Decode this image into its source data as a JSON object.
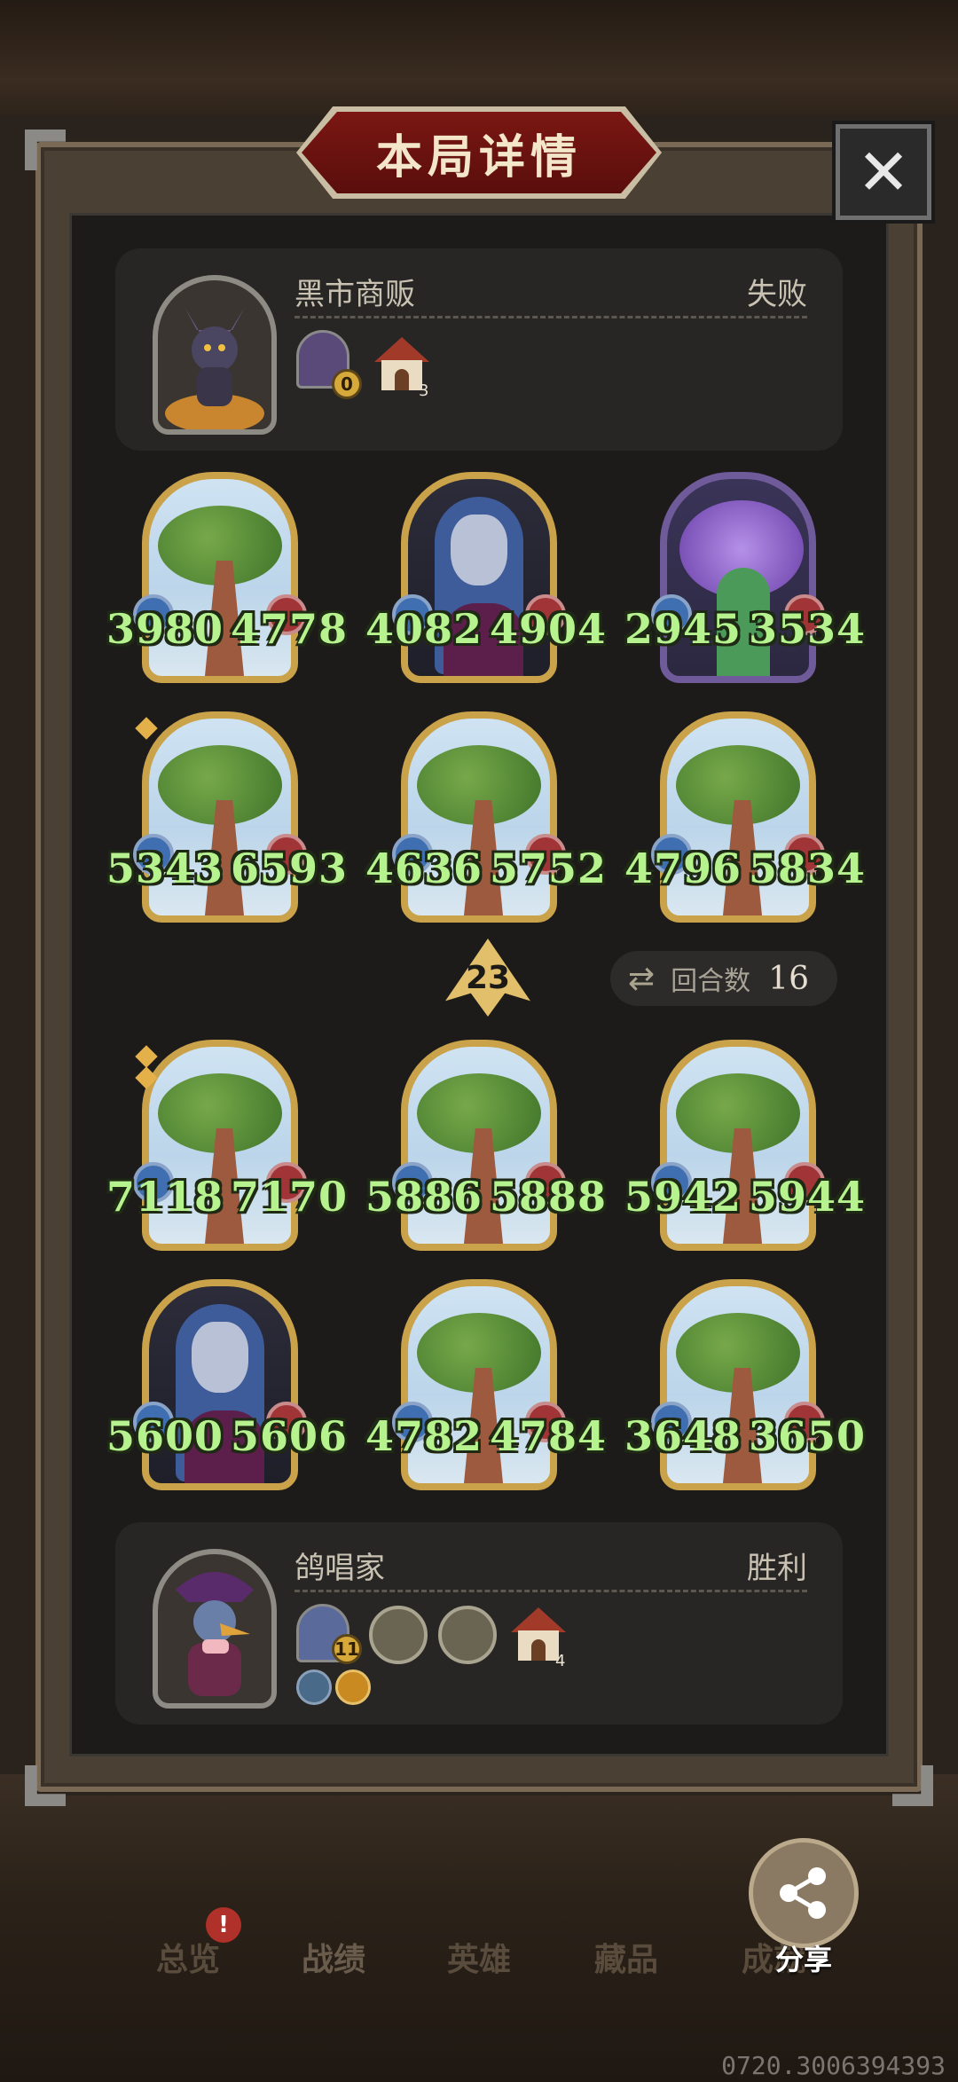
{
  "header": {
    "title": "本局详情",
    "close_label": "✕"
  },
  "opponent": {
    "name": "黑市商贩",
    "result": "失败",
    "gold": "0",
    "hut_count": "3"
  },
  "player": {
    "name": "鸽唱家",
    "result": "胜利",
    "gold": "11",
    "hut_count": "4"
  },
  "opponent_board": [
    {
      "type": "tree",
      "attack": "3980",
      "health": "4778"
    },
    {
      "type": "elf",
      "attack": "4082",
      "health": "4904"
    },
    {
      "type": "fairy",
      "attack": "2945",
      "health": "3534"
    },
    {
      "type": "tree",
      "attack": "5343",
      "health": "6593"
    },
    {
      "type": "tree",
      "attack": "4636",
      "health": "5752"
    },
    {
      "type": "tree",
      "attack": "4796",
      "health": "5834"
    }
  ],
  "player_board": [
    {
      "type": "tree",
      "attack": "7118",
      "health": "7170"
    },
    {
      "type": "tree",
      "attack": "5886",
      "health": "5888"
    },
    {
      "type": "tree",
      "attack": "5942",
      "health": "5944"
    },
    {
      "type": "elf",
      "attack": "5600",
      "health": "5606"
    },
    {
      "type": "tree",
      "attack": "4782",
      "health": "4784"
    },
    {
      "type": "tree",
      "attack": "3648",
      "health": "3650"
    }
  ],
  "turn_marker": "23",
  "rounds": {
    "label": "回合数",
    "value": "16"
  },
  "nav": {
    "items": [
      "总览",
      "战绩",
      "英雄",
      "藏品",
      "成就"
    ],
    "badge": "!",
    "share_label": "分享"
  },
  "version": "0720.3006394393"
}
